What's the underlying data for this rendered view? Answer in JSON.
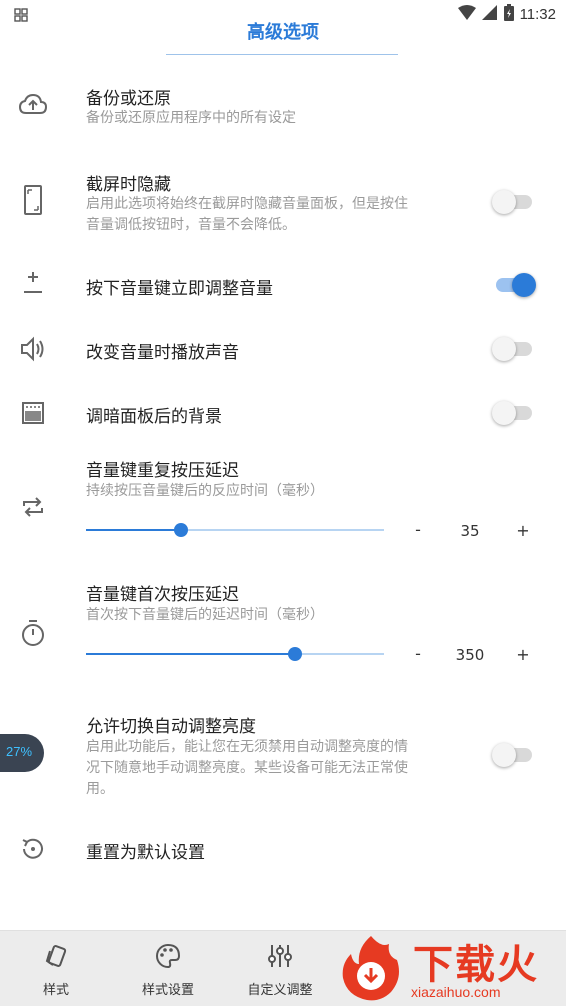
{
  "status": {
    "time": "11:32"
  },
  "header": {
    "title": "高级选项"
  },
  "settings": {
    "backup": {
      "title": "备份或还原",
      "desc": "备份或还原应用程序中的所有设定"
    },
    "hide_screenshot": {
      "title": "截屏时隐藏",
      "desc1": "启用此选项将始终在截屏时隐藏音量面板，但是按住",
      "desc2": "音量调低按钮时，音量不会降低。",
      "enabled": false
    },
    "instant_adjust": {
      "title": "按下音量键立即调整音量",
      "enabled": true
    },
    "play_sound": {
      "title": "改变音量时播放声音",
      "enabled": false
    },
    "dim_background": {
      "title": "调暗面板后的背景",
      "enabled": false
    },
    "repeat_delay": {
      "title": "音量键重复按压延迟",
      "desc": "持续按压音量键后的反应时间（毫秒）",
      "value": "35",
      "minus": "-",
      "plus": "+",
      "fraction": 0.32
    },
    "first_delay": {
      "title": "音量键首次按压延迟",
      "desc": "首次按下音量键后的延迟时间（毫秒）",
      "value": "350",
      "minus": "-",
      "plus": "+",
      "fraction": 0.7
    },
    "auto_brightness": {
      "title": "允许切换自动调整亮度",
      "desc1": "启用此功能后，能让您在无须禁用自动调整亮度的情",
      "desc2": "况下随意地手动调整亮度。某些设备可能无法正常使",
      "desc3": "用。",
      "enabled": false
    },
    "reset": {
      "title": "重置为默认设置"
    }
  },
  "overlay": {
    "text": "27%"
  },
  "bottom_nav": {
    "items": [
      {
        "label": "样式",
        "icon": "style-cards-icon"
      },
      {
        "label": "样式设置",
        "icon": "palette-icon"
      },
      {
        "label": "自定义调整",
        "icon": "equalizer-icon"
      }
    ]
  },
  "watermark": {
    "text": "下载火",
    "url": "xiazaihuo.com"
  },
  "colors": {
    "accent": "#2b7bd8",
    "brand": "#e63a22"
  }
}
